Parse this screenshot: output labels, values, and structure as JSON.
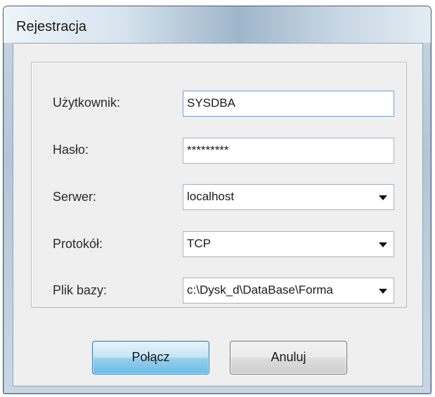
{
  "window": {
    "title": "Rejestracja"
  },
  "form": {
    "user": {
      "label": "Użytkownik:",
      "value": "SYSDBA"
    },
    "password": {
      "label": "Hasło:",
      "value": "*********"
    },
    "server": {
      "label": "Serwer:",
      "value": "localhost"
    },
    "protocol": {
      "label": "Protokół:",
      "value": "TCP"
    },
    "database": {
      "label": "Plik bazy:",
      "value": "c:\\Dysk_d\\DataBase\\Forma"
    }
  },
  "buttons": {
    "connect": "Połącz",
    "cancel": "Anuluj"
  },
  "icons": {
    "dropdown": "chevron-down-icon"
  }
}
